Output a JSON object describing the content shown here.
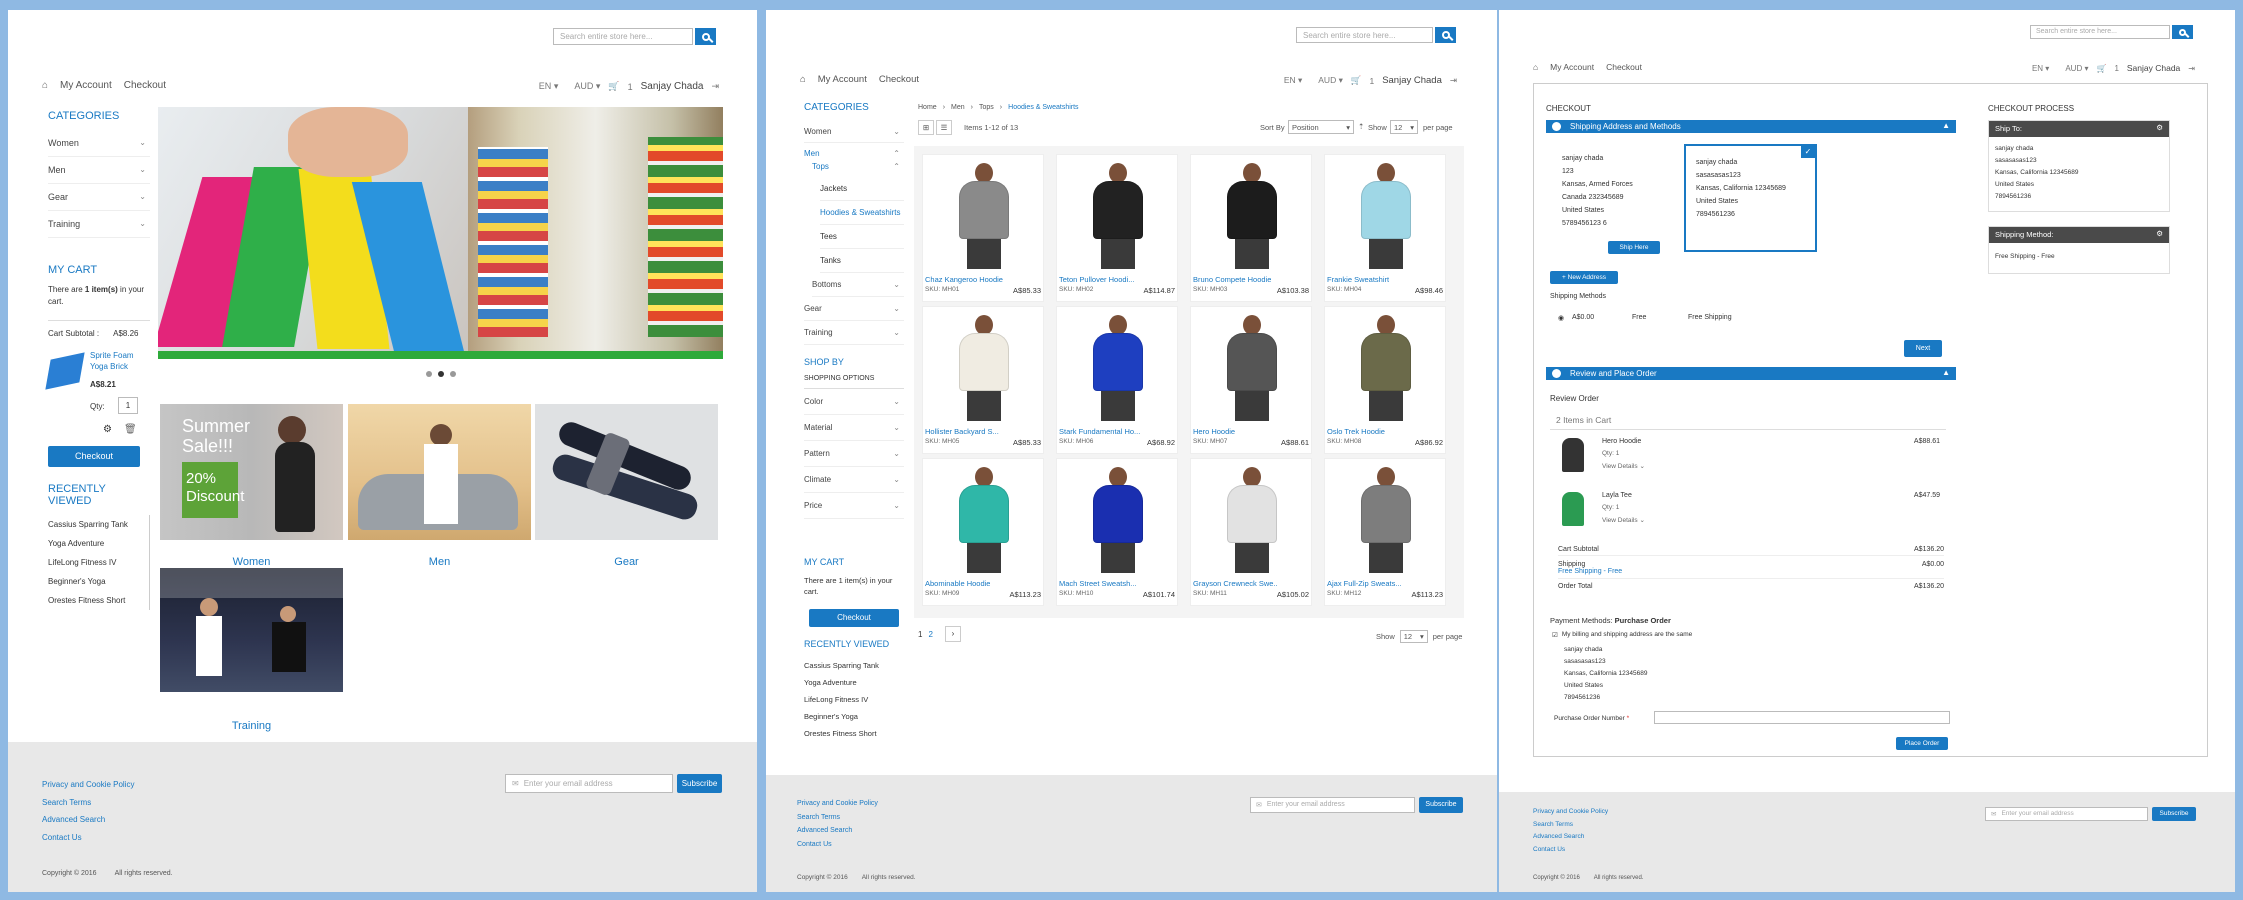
{
  "colors": {
    "accent": "#1979c3",
    "background": "#8fb9e3"
  },
  "search": {
    "placeholder": "Search entire store here..."
  },
  "nav": {
    "my_account": "My Account",
    "checkout": "Checkout",
    "lang": "EN",
    "currency": "AUD",
    "cart_count": "1",
    "user": "Sanjay Chada"
  },
  "icons": {
    "home": "home-icon",
    "cart": "cart-icon",
    "logout": "logout-icon",
    "search": "search-icon"
  },
  "p1": {
    "categories_title": "CATEGORIES",
    "categories": [
      "Women",
      "Men",
      "Gear",
      "Training"
    ],
    "cart_title": "MY CART",
    "cart_pre": "There are ",
    "cart_bold": "1 item(s)",
    "cart_post": " in your cart.",
    "cart_subtotal_label": "Cart Subtotal :",
    "cart_subtotal": "A$8.26",
    "cart_item_name": "Sprite Foam Yoga Brick",
    "cart_item_price": "A$8.21",
    "qty_label": "Qty:",
    "qty": "1",
    "checkout_btn": "Checkout",
    "recent_title": "RECENTLY VIEWED",
    "recent": [
      "Cassius Sparring Tank",
      "Yoga Adventure",
      "LifeLong Fitness IV",
      "Beginner's Yoga",
      "Orestes Fitness Short"
    ],
    "tiles": [
      "Women",
      "Men",
      "Gear",
      "Training"
    ],
    "promo_line1": "Summer",
    "promo_line2": "Sale!!!",
    "promo_line3": "20%",
    "promo_line4": "Discount"
  },
  "footer": {
    "links": [
      "Privacy and Cookie Policy",
      "Search Terms",
      "Advanced Search",
      "Contact Us"
    ],
    "email_placeholder": "Enter your email address",
    "subscribe": "Subscribe",
    "copyright": "Copyright © 2016",
    "rights": "All rights reserved."
  },
  "p2": {
    "categories_title": "CATEGORIES",
    "cats": {
      "women": "Women",
      "men": "Men",
      "tops": "Tops",
      "jackets": "Jackets",
      "hoodies": "Hoodies & Sweatshirts",
      "tees": "Tees",
      "tanks": "Tanks",
      "bottoms": "Bottoms",
      "gear": "Gear",
      "training": "Training"
    },
    "shop_by": "SHOP BY",
    "shopping_options": "SHOPPING OPTIONS",
    "filters": [
      "Color",
      "Material",
      "Pattern",
      "Climate",
      "Price"
    ],
    "cart_title": "MY CART",
    "cart_text": "There are 1 item(s) in your cart.",
    "checkout_btn": "Checkout",
    "recent_title": "RECENTLY VIEWED",
    "recent": [
      "Cassius Sparring Tank",
      "Yoga Adventure",
      "LifeLong Fitness IV",
      "Beginner's Yoga",
      "Orestes Fitness Short"
    ],
    "breadcrumb": [
      "Home",
      "Men",
      "Tops",
      "Hoodies & Sweatshirts"
    ],
    "items_text": "Items 1-12 of 13",
    "sort_label": "Sort By",
    "sort_value": "Position",
    "show_label": "Show",
    "show_value": "12",
    "per_page": "per page",
    "pages": [
      "1",
      "2"
    ],
    "products": [
      {
        "name": "Chaz Kangeroo Hoodie",
        "sku": "SKU: MH01",
        "price": "A$85.33",
        "color": "#8a8a8a"
      },
      {
        "name": "Teton Pullover Hoodi...",
        "sku": "SKU: MH02",
        "price": "A$114.87",
        "color": "#222222"
      },
      {
        "name": "Bruno Compete Hoodie",
        "sku": "SKU: MH03",
        "price": "A$103.38",
        "color": "#1c1c1c"
      },
      {
        "name": "Frankie Sweatshirt",
        "sku": "SKU: MH04",
        "price": "A$98.46",
        "color": "#9fd7e6"
      },
      {
        "name": "Hollister Backyard S...",
        "sku": "SKU: MH05",
        "price": "A$85.33",
        "color": "#f0ece2"
      },
      {
        "name": "Stark Fundamental Ho...",
        "sku": "SKU: MH06",
        "price": "A$68.92",
        "color": "#1e3fc0"
      },
      {
        "name": "Hero Hoodie",
        "sku": "SKU: MH07",
        "price": "A$88.61",
        "color": "#555555"
      },
      {
        "name": "Oslo Trek Hoodie",
        "sku": "SKU: MH08",
        "price": "A$86.92",
        "color": "#6b6a4a"
      },
      {
        "name": "Abominable Hoodie",
        "sku": "SKU: MH09",
        "price": "A$113.23",
        "color": "#2fb7a8"
      },
      {
        "name": "Mach Street Sweatsh...",
        "sku": "SKU: MH10",
        "price": "A$101.74",
        "color": "#1a2fb0"
      },
      {
        "name": "Grayson Crewneck Swe...",
        "sku": "SKU: MH11",
        "price": "A$105.02",
        "color": "#e2e2e2"
      },
      {
        "name": "Ajax Full-Zip Sweats...",
        "sku": "SKU: MH12",
        "price": "A$113.23",
        "color": "#7d7d7d"
      }
    ]
  },
  "p3": {
    "checkout_title": "CHECKOUT",
    "shipping_header": "Shipping Address and Methods",
    "addr1": [
      "sanjay chada",
      "123",
      "Kansas, Armed Forces",
      "Canada 232345689",
      "United States",
      "5789456123 6"
    ],
    "addr2": [
      "sanjay chada",
      "sasasasas123",
      "Kansas, California 12345689",
      "United States",
      "7894561236"
    ],
    "ship_here": "Ship Here",
    "new_address": "+ New Address",
    "shipping_methods": "Shipping Methods",
    "method": {
      "price": "A$0.00",
      "type": "Free",
      "carrier": "Free Shipping"
    },
    "next": "Next",
    "review_header": "Review and Place Order",
    "review_order": "Review Order",
    "items_in_cart": "2 Items in Cart",
    "items": [
      {
        "name": "Hero Hoodie",
        "qty": "Qty: 1",
        "details": "View Details",
        "price": "A$88.61"
      },
      {
        "name": "Layla Tee",
        "qty": "Qty: 1",
        "details": "View Details",
        "price": "A$47.59"
      }
    ],
    "cart_subtotal_label": "Cart Subtotal",
    "cart_subtotal": "A$136.20",
    "shipping_label": "Shipping",
    "shipping_value": "A$0.00",
    "shipping_method": "Free Shipping - Free",
    "order_total_label": "Order Total",
    "order_total": "A$136.20",
    "payment_label": "Payment Methods: ",
    "payment_value": "Purchase Order",
    "same_address": "My billing and shipping address are the same",
    "billing": [
      "sanjay chada",
      "sasasasas123",
      "Kansas, California 12345689",
      "United States",
      "7894561236"
    ],
    "po_label": "Purchase Order Number",
    "place_order": "Place Order",
    "process_title": "CHECKOUT PROCESS",
    "ship_to": "Ship To:",
    "ship_to_addr": [
      "sanjay chada",
      "sasasasas123",
      "Kansas, California 12345689",
      "United States",
      "7894561236"
    ],
    "shipping_method_title": "Shipping Method:",
    "shipping_method_value": "Free Shipping - Free"
  }
}
